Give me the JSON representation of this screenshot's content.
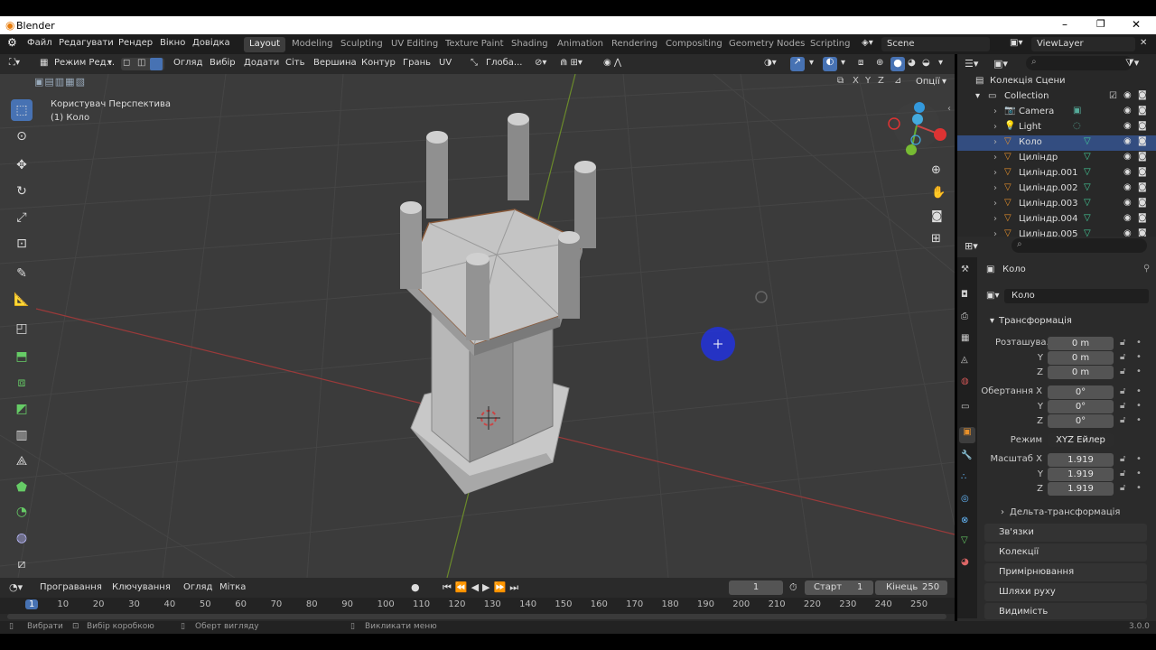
{
  "window": {
    "title": "Blender",
    "minimize": "–",
    "maximize": "❐",
    "close": "✕"
  },
  "menu": {
    "items": [
      "Файл",
      "Редагувати",
      "Рендер",
      "Вікно",
      "Довідка"
    ],
    "workspaces": [
      "Layout",
      "Modeling",
      "Sculpting",
      "UV Editing",
      "Texture Paint",
      "Shading",
      "Animation",
      "Rendering",
      "Compositing",
      "Geometry Nodes",
      "Scripting"
    ],
    "scene": "Scene",
    "view_layer": "ViewLayer"
  },
  "viewport_header": {
    "mode": "Режим Ред...",
    "menus": [
      "Огляд",
      "Вибір",
      "Додати",
      "Сіть",
      "Вершина",
      "Контур",
      "Грань",
      "UV"
    ],
    "transform_orientation": "Глоба...",
    "axes": [
      "X",
      "Y",
      "Z"
    ],
    "options": "Опції"
  },
  "viewport": {
    "view_name": "Користувач Перспектива",
    "object_name": "(1) Коло"
  },
  "outliner": {
    "scene_collection": "Колекція Сцени",
    "collection": "Collection",
    "items": [
      {
        "name": "Camera",
        "type": "camera",
        "selected": false
      },
      {
        "name": "Light",
        "type": "light",
        "selected": false
      },
      {
        "name": "Коло",
        "type": "mesh",
        "selected": true
      },
      {
        "name": "Циліндр",
        "type": "mesh",
        "selected": false
      },
      {
        "name": "Циліндр.001",
        "type": "mesh",
        "selected": false
      },
      {
        "name": "Циліндр.002",
        "type": "mesh",
        "selected": false
      },
      {
        "name": "Циліндр.003",
        "type": "mesh",
        "selected": false
      },
      {
        "name": "Циліндр.004",
        "type": "mesh",
        "selected": false
      },
      {
        "name": "Циліндр.005",
        "type": "mesh",
        "selected": false
      }
    ]
  },
  "properties": {
    "object_name": "Коло",
    "object_field": "Коло",
    "transform_title": "Трансформація",
    "location_label": "Розташува...",
    "location": [
      "0 m",
      "0 m",
      "0 m"
    ],
    "rotation_label": "Обертання X",
    "rotation": [
      "0°",
      "0°",
      "0°"
    ],
    "mode_label": "Режим",
    "mode_value": "XYZ Ейлер",
    "scale_label": "Масштаб X",
    "scale": [
      "1.919",
      "1.919",
      "1.919"
    ],
    "axis_y": "Y",
    "axis_z": "Z",
    "delta": "Дельта-трансформація",
    "panels": [
      "Зв'язки",
      "Колекції",
      "Примірнювання",
      "Шляхи руху",
      "Видимість"
    ]
  },
  "timeline": {
    "menus": [
      "Програвання",
      "Ключування",
      "Огляд",
      "Мітка"
    ],
    "current_frame": "1",
    "start_label": "Старт",
    "start": "1",
    "end_label": "Кінець",
    "end": "250",
    "ruler": [
      "1",
      "10",
      "20",
      "30",
      "40",
      "50",
      "60",
      "70",
      "80",
      "90",
      "100",
      "110",
      "120",
      "130",
      "140",
      "150",
      "160",
      "170",
      "180",
      "190",
      "200",
      "210",
      "220",
      "230",
      "240",
      "250"
    ]
  },
  "status": {
    "select": "Вибрати",
    "box_select": "Вибір коробкою",
    "rotate_view": "Оберт вигляду",
    "call_menu": "Викликати меню",
    "version": "3.0.0"
  }
}
